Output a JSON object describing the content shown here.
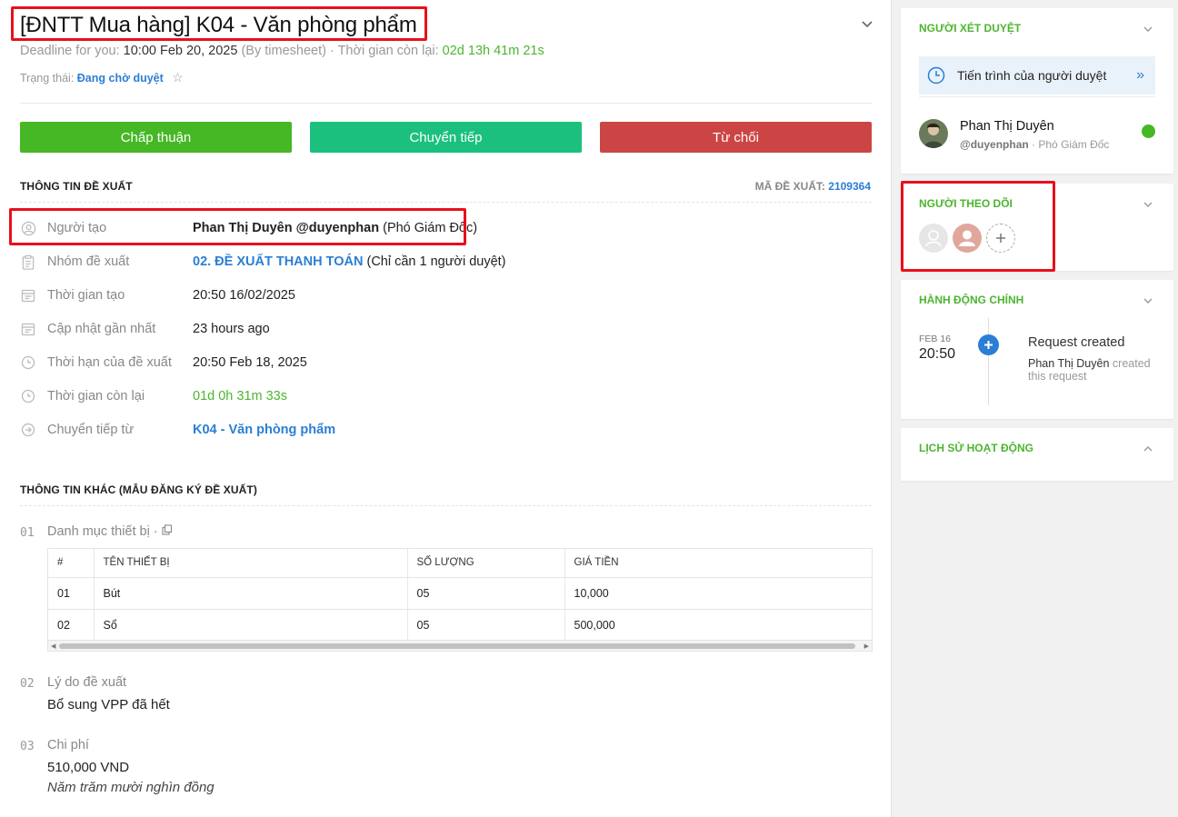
{
  "header": {
    "title": "[ĐNTT Mua hàng] K04 - Văn phòng phẩm",
    "deadline_label": "Deadline for you:",
    "deadline_value": "10:00 Feb 20, 2025",
    "deadline_suffix": "(By timesheet) · Thời gian còn lại:",
    "remaining": "02d 13h 41m 21s",
    "status_label": "Trạng thái:",
    "status_value": "Đang chờ duyệt"
  },
  "actions": {
    "approve": "Chấp thuận",
    "forward": "Chuyển tiếp",
    "reject": "Từ chối"
  },
  "proposal_info": {
    "heading": "THÔNG TIN ĐỀ XUẤT",
    "code_label": "MÃ ĐỀ XUẤT:",
    "code_value": "2109364",
    "rows": [
      {
        "label": "Người tạo",
        "value_bold": "Phan Thị Duyên @duyenphan",
        "value_rest": "(Phó Giám Đốc)"
      },
      {
        "label": "Nhóm đề xuất",
        "value_link": "02. ĐỀ XUẤT THANH TOÁN",
        "value_rest": "(Chỉ cần 1 người duyệt)"
      },
      {
        "label": "Thời gian tạo",
        "value": "20:50 16/02/2025"
      },
      {
        "label": "Cập nhật gần nhất",
        "value": "23 hours ago"
      },
      {
        "label": "Thời hạn của đề xuất",
        "value": "20:50 Feb 18, 2025"
      },
      {
        "label": "Thời gian còn lại",
        "value": "01d 0h 31m 33s"
      },
      {
        "label": "Chuyển tiếp từ",
        "value_link": "K04 - Văn phòng phẩm"
      }
    ]
  },
  "other_info": {
    "heading": "THÔNG TIN KHÁC (MẪU ĐĂNG KÝ ĐỀ XUẤT)",
    "fields": [
      {
        "num": "01",
        "label": "Danh mục thiết bị ·"
      },
      {
        "num": "02",
        "label": "Lý do đề xuất",
        "value": "Bổ sung VPP đã hết"
      },
      {
        "num": "03",
        "label": "Chi phí",
        "value": "510,000 VND",
        "note": "Năm trăm mười nghìn đồng"
      }
    ],
    "table": {
      "headers": [
        "#",
        "TÊN THIẾT BỊ",
        "SỐ LƯỢNG",
        "GIÁ TIỀN"
      ],
      "rows": [
        [
          "01",
          "Bút",
          "05",
          "10,000"
        ],
        [
          "02",
          "Sổ",
          "05",
          "500,000"
        ]
      ]
    }
  },
  "sidebar": {
    "reviewers": {
      "heading": "NGƯỜI XÉT DUYỆT",
      "progress_label": "Tiến trình của người duyệt",
      "approver_name": "Phan Thị Duyên",
      "approver_handle": "@duyenphan",
      "approver_role": "· Phó Giám Đốc"
    },
    "followers": {
      "heading": "NGƯỜI THEO DÕI"
    },
    "main_actions": {
      "heading": "HÀNH ĐỘNG CHÍNH",
      "date_small": "FEB 16",
      "time": "20:50",
      "event_title": "Request created",
      "event_actor": "Phan Thị Duyên",
      "event_desc": "created this request"
    },
    "history": {
      "heading": "LỊCH SỬ HOẠT ĐỘNG"
    }
  },
  "colors": {
    "accent_green": "#46b725",
    "link_blue": "#2a7fd4",
    "reject_red": "#cc4545",
    "forward_teal": "#1bc07f",
    "highlight_red": "#e8101a"
  }
}
